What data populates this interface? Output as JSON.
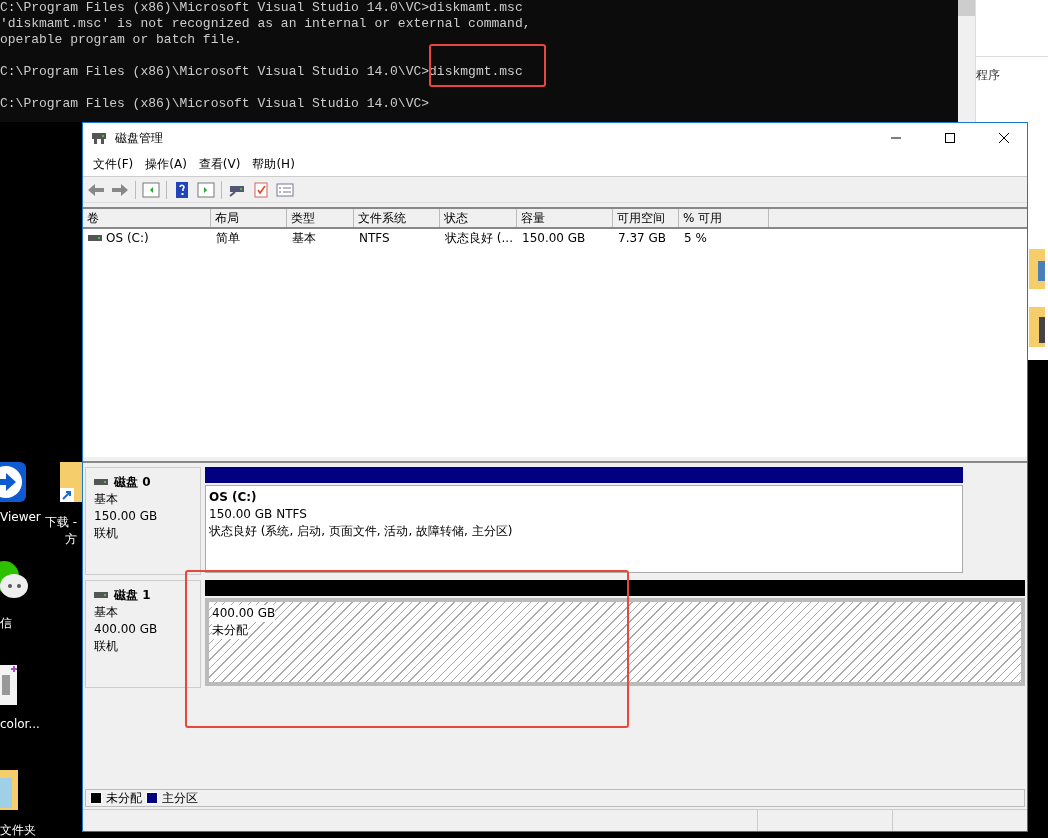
{
  "console": {
    "blocks": [
      [
        "C:\\Program Files (x86)\\Microsoft Visual Studio 14.0\\VC>diskmamt.msc",
        "'diskmamt.msc' is not recognized as an internal or external command,",
        "operable program or batch file."
      ],
      [
        "C:\\Program Files (x86)\\Microsoft Visual Studio 14.0\\VC>diskmgmt.msc"
      ],
      [
        "C:\\Program Files (x86)\\Microsoft Visual Studio 14.0\\VC>"
      ]
    ]
  },
  "background_window": {
    "label": "程序"
  },
  "desktop_icons": [
    {
      "kind": "app",
      "label": "Viewer"
    },
    {
      "kind": "shortcut",
      "label": "下载 -",
      "label_2": "方"
    },
    {
      "kind": "chat",
      "label": "信"
    },
    {
      "kind": "file",
      "label": "color..."
    },
    {
      "kind": "folder",
      "label": "文件夹"
    }
  ],
  "window": {
    "title": "磁盘管理",
    "menu": [
      "文件(F)",
      "操作(A)",
      "查看(V)",
      "帮助(H)"
    ],
    "volume_table": {
      "columns": [
        "卷",
        "布局",
        "类型",
        "文件系统",
        "状态",
        "容量",
        "可用空间",
        "% 可用"
      ],
      "rows": [
        {
          "cells": [
            "OS (C:)",
            "简单",
            "基本",
            "NTFS",
            "状态良好 (...",
            "150.00 GB",
            "7.37 GB",
            "5 %"
          ]
        }
      ]
    },
    "disks": [
      {
        "name": "磁盘 0",
        "type": "基本",
        "size": "150.00 GB",
        "status": "联机",
        "partitions": [
          {
            "kind": "primary",
            "name": "OS  (C:)",
            "size": "150.00 GB NTFS",
            "status": "状态良好 (系统, 启动, 页面文件, 活动, 故障转储, 主分区)"
          }
        ]
      },
      {
        "name": "磁盘 1",
        "type": "基本",
        "size": "400.00 GB",
        "status": "联机",
        "partitions": [
          {
            "kind": "unallocated",
            "size": "400.00 GB",
            "status": "未分配"
          }
        ]
      }
    ],
    "legend": [
      {
        "label": "未分配",
        "color": "#000000"
      },
      {
        "label": "主分区",
        "color": "#000080"
      }
    ]
  }
}
